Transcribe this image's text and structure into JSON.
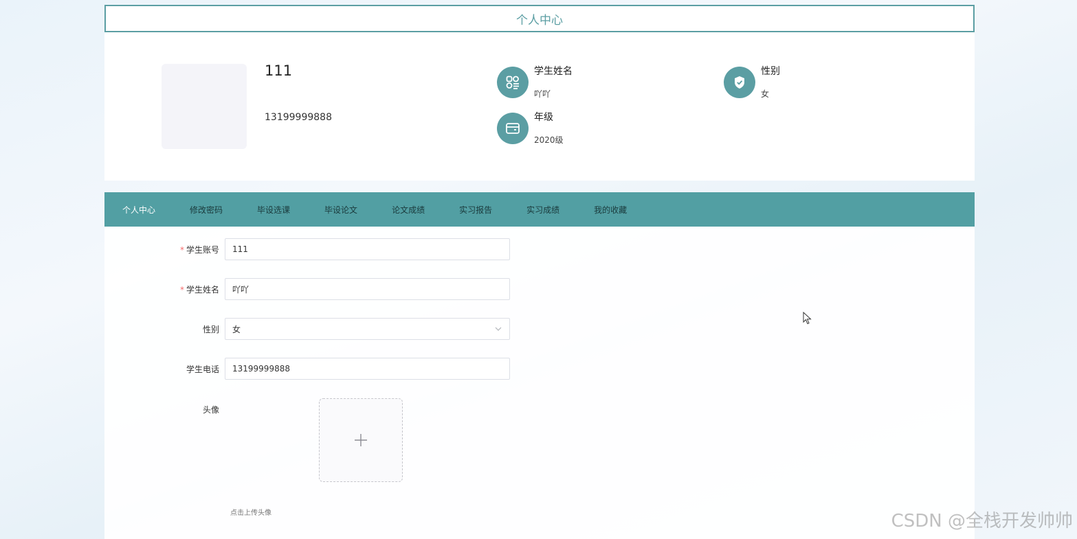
{
  "page": {
    "title": "个人中心"
  },
  "profile": {
    "username": "111",
    "phone": "13199999888",
    "info": [
      {
        "label": "学生姓名",
        "value": "吖吖",
        "icon": "grid-list-icon"
      },
      {
        "label": "性别",
        "value": "女",
        "icon": "shield-check-icon"
      },
      {
        "label": "年级",
        "value": "2020级",
        "icon": "wallet-card-icon"
      }
    ]
  },
  "tabs": [
    {
      "label": "个人中心",
      "active": true
    },
    {
      "label": "修改密码"
    },
    {
      "label": "毕设选课"
    },
    {
      "label": "毕设论文"
    },
    {
      "label": "论文成绩"
    },
    {
      "label": "实习报告"
    },
    {
      "label": "实习成绩"
    },
    {
      "label": "我的收藏"
    }
  ],
  "form": {
    "account_label": "学生账号",
    "account_value": "111",
    "name_label": "学生姓名",
    "name_value": "吖吖",
    "gender_label": "性别",
    "gender_value": "女",
    "phone_label": "学生电话",
    "phone_value": "13199999888",
    "avatar_label": "头像",
    "upload_hint": "点击上传头像"
  },
  "watermark": "CSDN @全栈开发帅帅",
  "colors": {
    "accent": "#5b9ea3",
    "tab_bar": "#529fa3",
    "required": "#f56c6c"
  }
}
